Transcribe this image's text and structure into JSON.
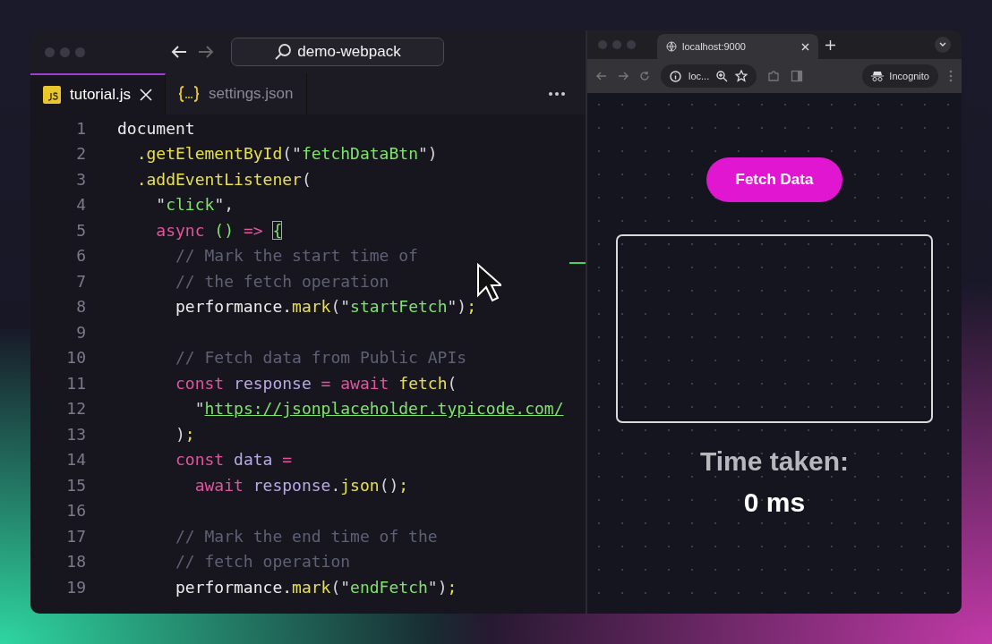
{
  "editor": {
    "search": "demo-webpack",
    "tabs": [
      {
        "label": "tutorial.js",
        "kind": "js",
        "selected": true
      },
      {
        "label": "settings.json",
        "kind": "json",
        "selected": false
      }
    ],
    "lines": [
      {
        "number": "1",
        "tokens": [
          {
            "kind": "plain",
            "text": "document"
          }
        ],
        "children": [
          {
            "number": "2",
            "tokens": [
              {
                "kind": "fn",
                "text": ".getElementById"
              },
              {
                "kind": "punct",
                "text": "(\""
              },
              {
                "kind": "str",
                "text": "fetchDataBtn"
              },
              {
                "kind": "punct",
                "text": "\")"
              }
            ]
          },
          {
            "number": "3",
            "tokens": [
              {
                "kind": "fn",
                "text": ".addEventListener"
              },
              {
                "kind": "punct",
                "text": "("
              }
            ],
            "children": [
              {
                "number": "4",
                "tokens": [
                  {
                    "kind": "punct",
                    "text": "\""
                  },
                  {
                    "kind": "str",
                    "text": "click"
                  },
                  {
                    "kind": "punct",
                    "text": "\","
                  }
                ]
              },
              {
                "number": "5",
                "tokens": [
                  {
                    "kind": "kw",
                    "text": "async"
                  },
                  {
                    "kind": "str",
                    "text": " ()"
                  },
                  {
                    "kind": "kw",
                    "text": " => "
                  },
                  {
                    "kind": "bracket",
                    "text": "{"
                  }
                ],
                "children": [
                  {
                    "number": "6",
                    "tokens": [
                      {
                        "kind": "comment",
                        "text": "// Mark the start time of"
                      }
                    ]
                  },
                  {
                    "number": "7",
                    "tokens": [
                      {
                        "kind": "comment",
                        "text": "// the fetch operation"
                      }
                    ]
                  },
                  {
                    "number": "8",
                    "tokens": [
                      {
                        "kind": "plain",
                        "text": "performance."
                      },
                      {
                        "kind": "fn",
                        "text": "mark"
                      },
                      {
                        "kind": "punct",
                        "text": "(\""
                      },
                      {
                        "kind": "str",
                        "text": "startFetch"
                      },
                      {
                        "kind": "punct",
                        "text": "\")"
                      },
                      {
                        "kind": "fn",
                        "text": ";"
                      }
                    ]
                  },
                  {
                    "number": "9"
                  },
                  {
                    "number": "10",
                    "tokens": [
                      {
                        "kind": "comment",
                        "text": "// Fetch data from Public APIs"
                      }
                    ]
                  },
                  {
                    "number": "11",
                    "tokens": [
                      {
                        "kind": "kw",
                        "text": "const"
                      },
                      {
                        "kind": "var",
                        "text": " response"
                      },
                      {
                        "kind": "kw",
                        "text": " = await"
                      },
                      {
                        "kind": "fn",
                        "text": " fetch"
                      },
                      {
                        "kind": "punct",
                        "text": "("
                      }
                    ],
                    "children": [
                      {
                        "number": "12",
                        "tokens": [
                          {
                            "kind": "punct",
                            "text": "\""
                          },
                          {
                            "kind": "url",
                            "text": "https://jsonplaceholder.typicode.com/"
                          }
                        ]
                      }
                    ]
                  },
                  {
                    "number": "13",
                    "tokens": [
                      {
                        "kind": "punct",
                        "text": ")"
                      },
                      {
                        "kind": "fn",
                        "text": ";"
                      }
                    ]
                  },
                  {
                    "number": "14",
                    "tokens": [
                      {
                        "kind": "kw",
                        "text": "const"
                      },
                      {
                        "kind": "var",
                        "text": " data"
                      },
                      {
                        "kind": "kw",
                        "text": " ="
                      }
                    ],
                    "children": [
                      {
                        "number": "15",
                        "tokens": [
                          {
                            "kind": "kw",
                            "text": "await"
                          },
                          {
                            "kind": "var",
                            "text": " response"
                          },
                          {
                            "kind": "punct",
                            "text": "."
                          },
                          {
                            "kind": "fn",
                            "text": "json"
                          },
                          {
                            "kind": "punct",
                            "text": "()"
                          },
                          {
                            "kind": "fn",
                            "text": ";"
                          }
                        ]
                      }
                    ]
                  },
                  {
                    "number": "16"
                  },
                  {
                    "number": "17",
                    "tokens": [
                      {
                        "kind": "comment",
                        "text": "// Mark the end time of the"
                      }
                    ]
                  },
                  {
                    "number": "18",
                    "tokens": [
                      {
                        "kind": "comment",
                        "text": "// fetch operation"
                      }
                    ]
                  },
                  {
                    "number": "19",
                    "tokens": [
                      {
                        "kind": "plain",
                        "text": "performance."
                      },
                      {
                        "kind": "fn",
                        "text": "mark"
                      },
                      {
                        "kind": "punct",
                        "text": "(\""
                      },
                      {
                        "kind": "str",
                        "text": "endFetch"
                      },
                      {
                        "kind": "punct",
                        "text": "\")"
                      },
                      {
                        "kind": "fn",
                        "text": ";"
                      }
                    ]
                  }
                ]
              }
            ]
          }
        ]
      }
    ]
  },
  "browser": {
    "tab": "localhost:9000",
    "address": "loc...",
    "incognito": "Incognito",
    "button": "Fetch Data",
    "time_label": "Time taken:",
    "time_value": "0 ms"
  }
}
